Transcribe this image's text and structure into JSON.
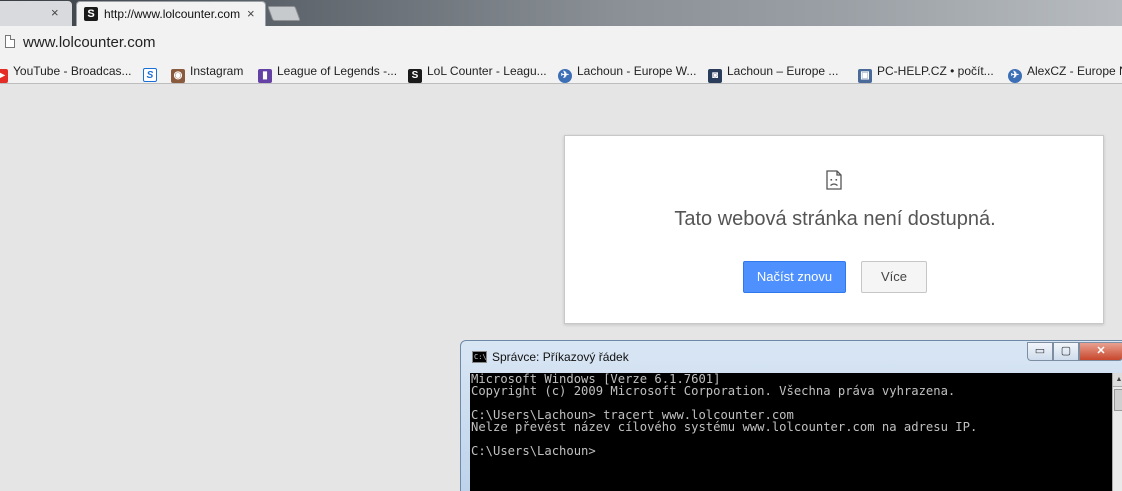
{
  "browser": {
    "tabs": [
      {
        "title": "",
        "close": "×"
      },
      {
        "title": "http://www.lolcounter.com",
        "favicon": "S",
        "close": "×"
      }
    ],
    "url": "www.lolcounter.com"
  },
  "bookmarks": [
    {
      "label": "YouTube - Broadcas...",
      "icon": "youtube-icon",
      "color": "#e52d27"
    },
    {
      "label": "",
      "icon": "s-icon",
      "color": "#1a6fd6"
    },
    {
      "label": "Instagram",
      "icon": "instagram-icon",
      "color": "#8a5a3c"
    },
    {
      "label": "League of Legends -...",
      "icon": "twitch-icon",
      "color": "#6441a5"
    },
    {
      "label": "LoL Counter - Leagu...",
      "icon": "lolcounter-icon",
      "color": "#1a1a1a"
    },
    {
      "label": "Lachoun - Europe W...",
      "icon": "lolking-icon",
      "color": "#3d6fb6"
    },
    {
      "label": "Lachoun – Europe ...",
      "icon": "opgg-icon",
      "color": "#2a3e5c"
    },
    {
      "label": "PC-HELP.CZ • počít...",
      "icon": "pchelp-icon",
      "color": "#4a6a9a"
    },
    {
      "label": "AlexCZ - Europe N",
      "icon": "lolking-icon",
      "color": "#3d6fb6"
    }
  ],
  "error": {
    "title": "Tato webová stránka není dostupná.",
    "reload_label": "Načíst znovu",
    "more_label": "Více"
  },
  "cmd": {
    "title": "Správce: Příkazový řádek",
    "buttons": {
      "minimize": "▭",
      "maximize": "▢",
      "close": "✕"
    },
    "lines": [
      "Microsoft Windows [Verze 6.1.7601]",
      "Copyright (c) 2009 Microsoft Corporation. Všechna práva vyhrazena.",
      "",
      "C:\\Users\\Lachoun> tracert www.lolcounter.com",
      "Nelze převést název cílového systému www.lolcounter.com na adresu IP.",
      "",
      "C:\\Users\\Lachoun>"
    ]
  }
}
